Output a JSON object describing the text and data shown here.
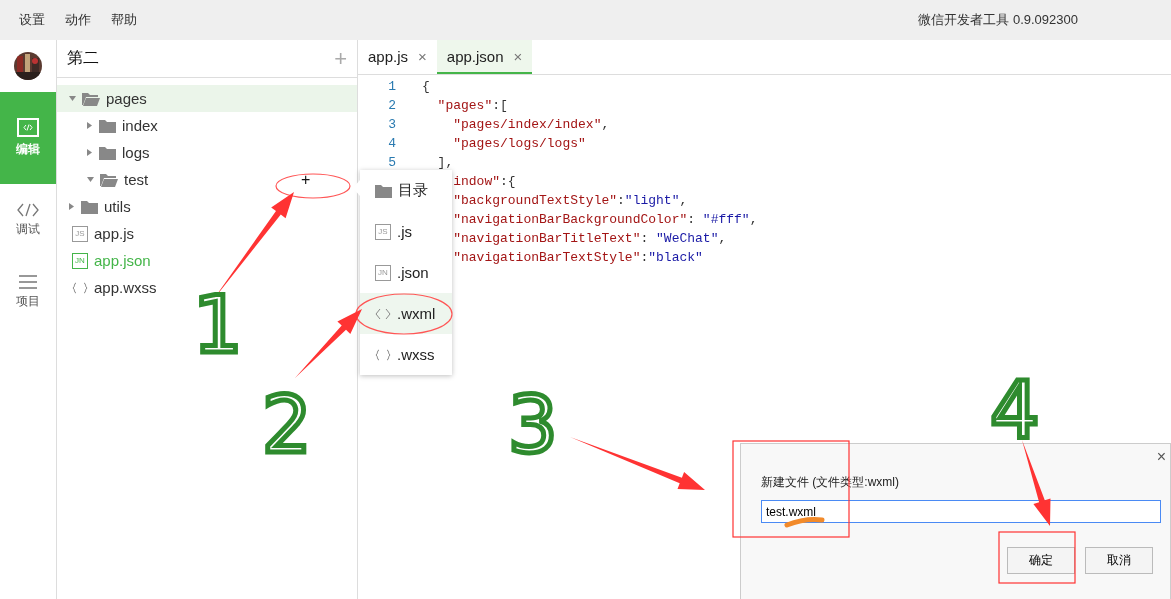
{
  "menu_bar": {
    "items": [
      "设置",
      "动作",
      "帮助"
    ],
    "title": "微信开发者工具 0.9.092300"
  },
  "rail": {
    "items": [
      {
        "label": "编辑",
        "kind": "code-box",
        "selected": true
      },
      {
        "label": "调试",
        "kind": "code",
        "selected": false
      },
      {
        "label": "项目",
        "kind": "list",
        "selected": false
      }
    ]
  },
  "project": {
    "title": "第二",
    "add": "+"
  },
  "tree": [
    {
      "name": "pages",
      "kind": "folder",
      "expanded": true,
      "selected": true,
      "current": false,
      "children": [
        {
          "name": "index",
          "kind": "folder",
          "expanded": false,
          "selected": false,
          "current": false
        },
        {
          "name": "logs",
          "kind": "folder",
          "expanded": false,
          "selected": false,
          "current": false
        },
        {
          "name": "test",
          "kind": "folder",
          "expanded": true,
          "selected": false,
          "current": false,
          "action": "+"
        }
      ]
    },
    {
      "name": "utils",
      "kind": "folder",
      "expanded": false,
      "selected": false,
      "current": false
    },
    {
      "name": "app.js",
      "kind": "js",
      "badge": "JS",
      "selected": false,
      "current": false
    },
    {
      "name": "app.json",
      "kind": "json",
      "badge": "JN",
      "selected": false,
      "current": true
    },
    {
      "name": "app.wxss",
      "kind": "wxss",
      "selected": false,
      "current": false
    }
  ],
  "tabs": [
    {
      "label": "app.js",
      "close": "×",
      "selected": false
    },
    {
      "label": "app.json",
      "close": "×",
      "selected": true
    }
  ],
  "code": [
    {
      "number": "1",
      "tokens": [
        {
          "text": "{",
          "kind": "punct"
        }
      ]
    },
    {
      "number": "2",
      "tokens": [
        {
          "text": "  \"pages\"",
          "kind": "key"
        },
        {
          "text": ":[",
          "kind": "punct"
        }
      ]
    },
    {
      "number": "3",
      "tokens": [
        {
          "text": "    \"pages/index/index\"",
          "kind": "key"
        },
        {
          "text": ",",
          "kind": "punct"
        }
      ]
    },
    {
      "number": "4",
      "tokens": [
        {
          "text": "    \"pages/logs/logs\"",
          "kind": "key"
        }
      ]
    },
    {
      "number": "5",
      "tokens": [
        {
          "text": "  ],",
          "kind": "punct"
        }
      ]
    },
    {
      "tokens": [
        {
          "text": "    indow\"",
          "kind": "key"
        },
        {
          "text": ":{",
          "kind": "punct"
        }
      ]
    },
    {
      "tokens": [
        {
          "text": "    \"backgroundTextStyle\"",
          "kind": "key"
        },
        {
          "text": ":",
          "kind": "punct"
        },
        {
          "text": "\"light\"",
          "kind": "string"
        },
        {
          "text": ",",
          "kind": "punct"
        }
      ]
    },
    {
      "tokens": [
        {
          "text": "    \"navigationBarBackgroundColor\"",
          "kind": "key"
        },
        {
          "text": ": ",
          "kind": "punct"
        },
        {
          "text": "\"#fff\"",
          "kind": "string"
        },
        {
          "text": ",",
          "kind": "punct"
        }
      ]
    },
    {
      "tokens": [
        {
          "text": "    \"navigationBarTitleText\"",
          "kind": "key"
        },
        {
          "text": ": ",
          "kind": "punct"
        },
        {
          "text": "\"WeChat\"",
          "kind": "string"
        },
        {
          "text": ",",
          "kind": "punct"
        }
      ]
    },
    {
      "tokens": [
        {
          "text": "    \"navigationBarTextStyle\"",
          "kind": "key"
        },
        {
          "text": ":",
          "kind": "punct"
        },
        {
          "text": "\"black\"",
          "kind": "string"
        }
      ]
    }
  ],
  "context_menu": [
    {
      "label": "目录",
      "kind": "folder",
      "selected": false
    },
    {
      "label": ".js",
      "kind": "js",
      "badge": "JS",
      "selected": false
    },
    {
      "label": ".json",
      "kind": "json",
      "badge": "JN",
      "selected": false
    },
    {
      "label": ".wxml",
      "kind": "wxml",
      "selected": true
    },
    {
      "label": ".wxss",
      "kind": "wxss",
      "selected": false
    }
  ],
  "dialog": {
    "close": "×",
    "title": "新建文件 (文件类型:wxml)",
    "value": "test.wxml",
    "buttons": [
      "确定",
      "取消"
    ]
  },
  "annotations": {
    "numbers": [
      "1",
      "2",
      "3",
      "4"
    ]
  }
}
